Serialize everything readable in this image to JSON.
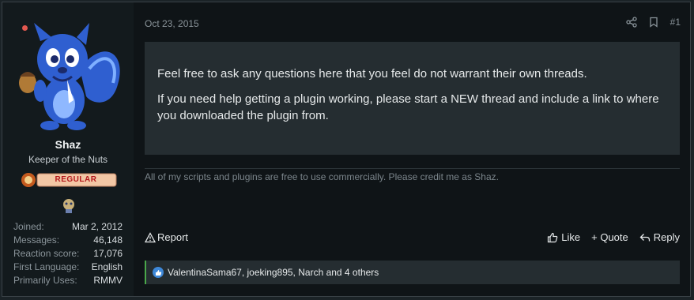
{
  "post": {
    "date": "Oct 23, 2015",
    "number": "#1",
    "message": [
      "Feel free to ask any questions here that you feel do not warrant their own threads.",
      "If you need help getting a plugin working, please start a NEW thread and include a link to where you downloaded the plugin from."
    ],
    "signature": "All of my scripts and plugins are free to use commercially. Please credit me as Shaz."
  },
  "user": {
    "name": "Shaz",
    "title": "Keeper of the Nuts",
    "banner": "REGULAR",
    "stats": [
      {
        "label": "Joined:",
        "value": "Mar 2, 2012"
      },
      {
        "label": "Messages:",
        "value": "46,148"
      },
      {
        "label": "Reaction score:",
        "value": "17,076"
      },
      {
        "label": "First Language:",
        "value": "English"
      },
      {
        "label": "Primarily Uses:",
        "value": "RMMV"
      }
    ]
  },
  "actions": {
    "report": "Report",
    "like": "Like",
    "quote": "+ Quote",
    "reply": "Reply"
  },
  "reactions": {
    "text": "ValentinaSama67, joeking895, Narch and 4 others"
  },
  "colors": {
    "accent_like": "#3e88d8",
    "reaction_bar": "#4aa84a",
    "online": "#e2584f"
  }
}
